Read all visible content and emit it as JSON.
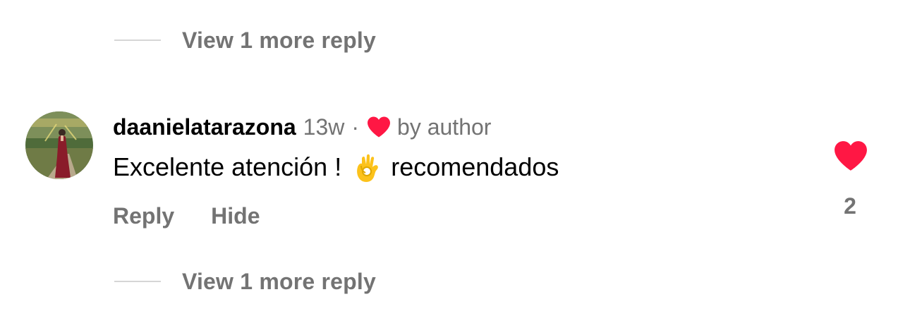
{
  "replies_toggle_top": {
    "label": "View 1 more reply"
  },
  "comment": {
    "username": "daanielatarazona",
    "timestamp": "13w",
    "separator": "·",
    "liked_by": "by author",
    "text_before_emoji": "Excelente atención !",
    "emoji": "ok-hand-emoji",
    "text_after_emoji": "recomendados",
    "actions": {
      "reply": "Reply",
      "hide": "Hide"
    },
    "like_count": "2"
  },
  "replies_toggle_bottom": {
    "label": "View 1 more reply"
  },
  "colors": {
    "text_primary": "#000000",
    "text_secondary": "#737373",
    "heart": "#ff1744",
    "divider": "#d6d6d6"
  }
}
